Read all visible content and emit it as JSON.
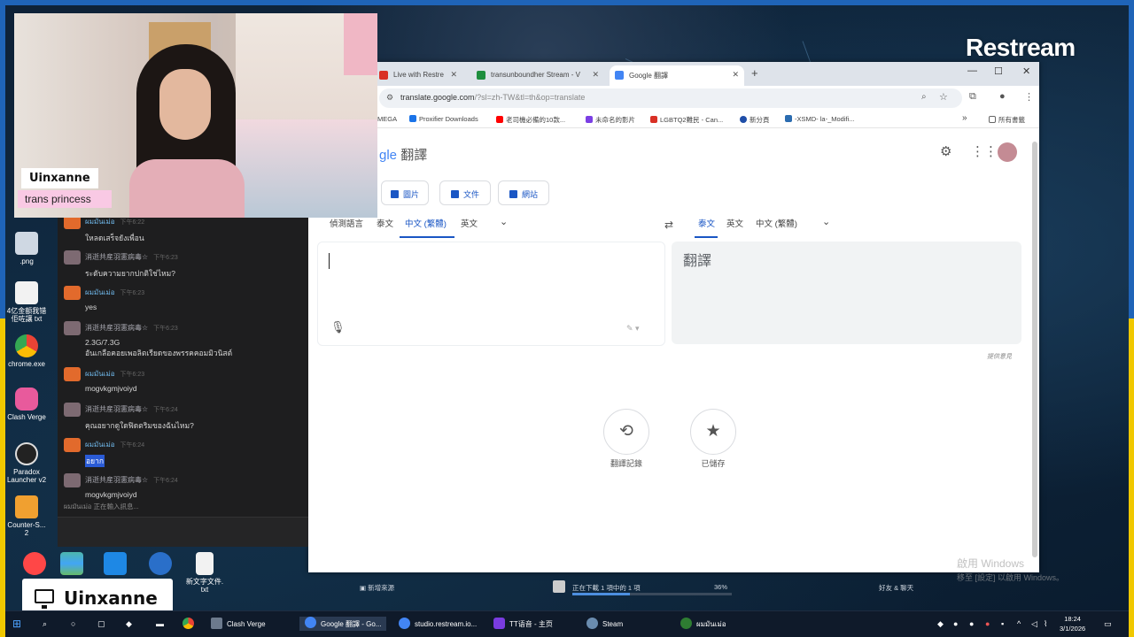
{
  "webcam": {
    "name": "Uinxanne",
    "subtitle": "trans princess"
  },
  "overlay": {
    "name": "Uinxanne",
    "monitor_icon": "monitor-icon"
  },
  "restream_logo": "Restream",
  "desktop_icons": [
    {
      "label": ".png"
    },
    {
      "label": "4亿金额我错\n佢咗讓 txt"
    },
    {
      "label": "chrome.exe"
    },
    {
      "label": "Clash Verge"
    },
    {
      "label": "Paradox\nLauncher v2"
    },
    {
      "label": "Counter-S...\n2"
    },
    {
      "label": "新文字文件.\ntxt"
    }
  ],
  "chat": {
    "messages": [
      {
        "user": "ผมมันเม่อ",
        "time": "下午6:22",
        "text": "ใหลดเสร็จยังเพื่อน",
        "user_style": "blue"
      },
      {
        "user": "消逝共産羽憲病毒☆",
        "time": "下午6:23",
        "text": "ระดับความยากปกติใช่ไหม?",
        "user_style": "grey"
      },
      {
        "user": "ผมมันเม่อ",
        "time": "下午6:23",
        "text": "yes",
        "user_style": "blue"
      },
      {
        "user": "消逝共産羽憲病毒☆",
        "time": "下午6:23",
        "text": "2.3G/7.3G\nอันเกลือคอยเพอลิตเรียดของพรรคคอมมิวนิสต์",
        "user_style": "grey"
      },
      {
        "user": "ผมมันเม่อ",
        "time": "下午6:23",
        "text": "mogvkgmjvoiyd",
        "user_style": "blue"
      },
      {
        "user": "消逝共産羽憲病毒☆",
        "time": "下午6:24",
        "text": "คุณอยากดูใดฟิดตริมของฉันไหม?",
        "user_style": "grey"
      },
      {
        "user": "ผมมันเม่อ",
        "time": "下午6:24",
        "text": "อยาก",
        "user_style": "blue",
        "selected": true
      },
      {
        "user": "消逝共産羽憲病毒☆",
        "time": "下午6:24",
        "text": "mogvkgmjvoiyd",
        "user_style": "grey"
      }
    ],
    "typing": "ผมมันเม่อ 正在輸入訊息..."
  },
  "browser": {
    "tabs": [
      {
        "label": "Live with Restre",
        "color": "#d93025"
      },
      {
        "label": "transunboundher Stream - V",
        "color": "#1e8e3e"
      },
      {
        "label": "Google 翻譯",
        "color": "#4285f4",
        "active": true
      }
    ],
    "url_main": "translate.google.com",
    "url_rest": "/?sl=zh-TW&tl=th&op=translate",
    "bookmarks": [
      {
        "label": "MEGA",
        "color": "#d93025"
      },
      {
        "label": "Proxifier Downloads",
        "color": "#1a73e8"
      },
      {
        "label": "老司機必備的10款...",
        "color": "#ff0000"
      },
      {
        "label": "未命名的影片",
        "color": "#7b3fe4"
      },
      {
        "label": "LGBTQ2難民 - Can...",
        "color": "#d93025"
      },
      {
        "label": "新分頁",
        "color": "#1f4ea8"
      },
      {
        "label": "-XSMD- la-_Modifi...",
        "color": "#2b6cb0"
      }
    ],
    "bookmarks_all": "所有書籤",
    "chevron": "»"
  },
  "translate": {
    "logo_prefix": "gle",
    "logo_title": "翻譯",
    "modes": [
      "圖片",
      "文件",
      "網站"
    ],
    "source_langs": [
      "偵測語言",
      "泰文",
      "中文 (繁體)",
      "英文"
    ],
    "target_langs": [
      "泰文",
      "英文",
      "中文 (繁體)"
    ],
    "target_text": "翻譯",
    "feedback": "提供意見",
    "history_label": "翻譯記錄",
    "saved_label": "已儲存",
    "activate_windows": "啟用 Windows"
  },
  "stream_bar": {
    "left": "新增來源",
    "center": "正在下載 1 項中的 1 項",
    "percent": "36%",
    "right": "好友 & 聊天"
  },
  "activate_windows_sub": "移至 [設定] 以啟用 Windows。",
  "taskbar": {
    "items": [
      {
        "label": "Clash Verge",
        "color": "#6c7a8d"
      },
      {
        "label": "Google 翻譯 - Go...",
        "color": "#4285f4"
      },
      {
        "label": "studio.restream.io...",
        "color": "#4285f4"
      },
      {
        "label": "TT语音 - 主页",
        "color": "#7a3ce0"
      },
      {
        "label": "Steam",
        "color": "#1b2838"
      },
      {
        "label": "ผมมันเม่อ",
        "color": "#2e7d32"
      }
    ],
    "time": "18:24",
    "date": "3/1/2026"
  }
}
